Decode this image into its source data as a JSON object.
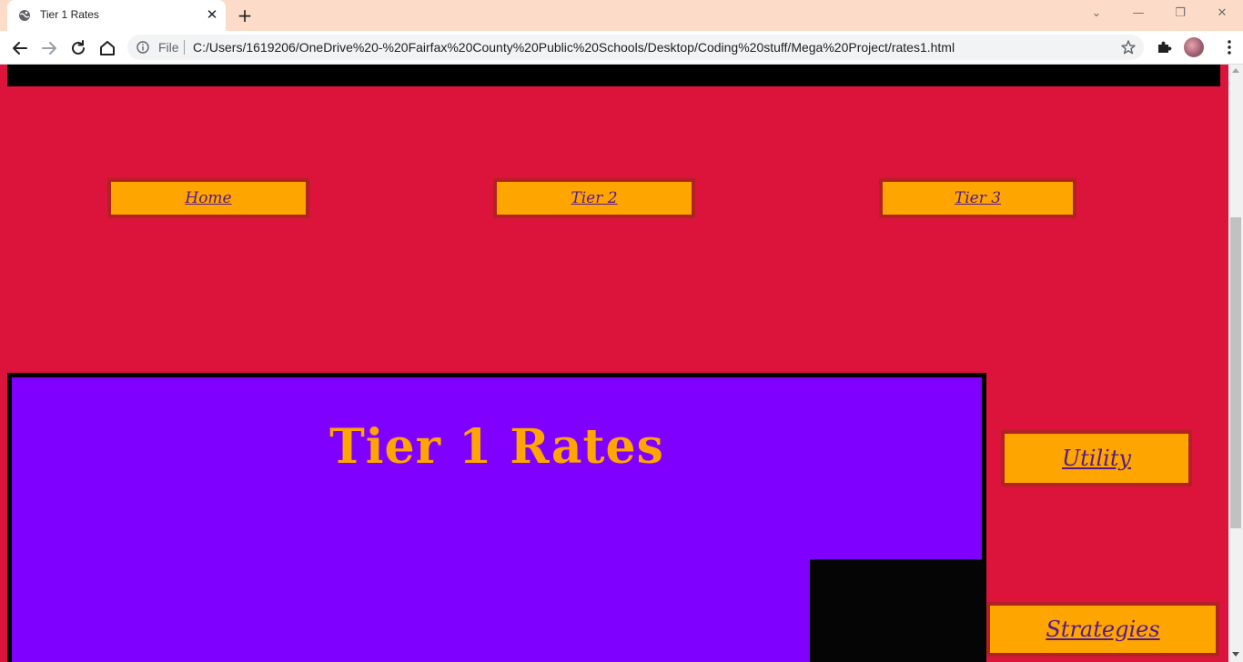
{
  "browser": {
    "tab_title": "Tier 1 Rates",
    "tab_close": "✕",
    "new_tab": "+",
    "omnibox": {
      "scheme_label": "File",
      "url": "C:/Users/1619206/OneDrive%20-%20Fairfax%20County%20Public%20Schools/Desktop/Coding%20stuff/Mega%20Project/rates1.html"
    },
    "window_controls": {
      "dropdown": "⌄",
      "minimize": "—",
      "restore": "❐",
      "close": "✕"
    }
  },
  "page": {
    "colors": {
      "background": "#dc143c",
      "button": "#ffa500",
      "button_border": "#b22222",
      "panel": "#8000ff",
      "title": "#ffa500",
      "link": "#551a8b"
    },
    "nav": [
      {
        "label": "Home"
      },
      {
        "label": "Tier 2"
      },
      {
        "label": "Tier 3"
      }
    ],
    "main_title": "Tier 1 Rates",
    "side_links": [
      {
        "label": "Utility"
      },
      {
        "label": "Strategies"
      }
    ]
  },
  "icons": {
    "tab_favicon": "globe-icon",
    "back": "back-arrow-icon",
    "forward": "forward-arrow-icon",
    "reload": "reload-icon",
    "home": "home-icon",
    "info": "info-icon",
    "bookmark": "star-icon",
    "extensions": "puzzle-icon",
    "menu": "kebab-menu-icon"
  }
}
